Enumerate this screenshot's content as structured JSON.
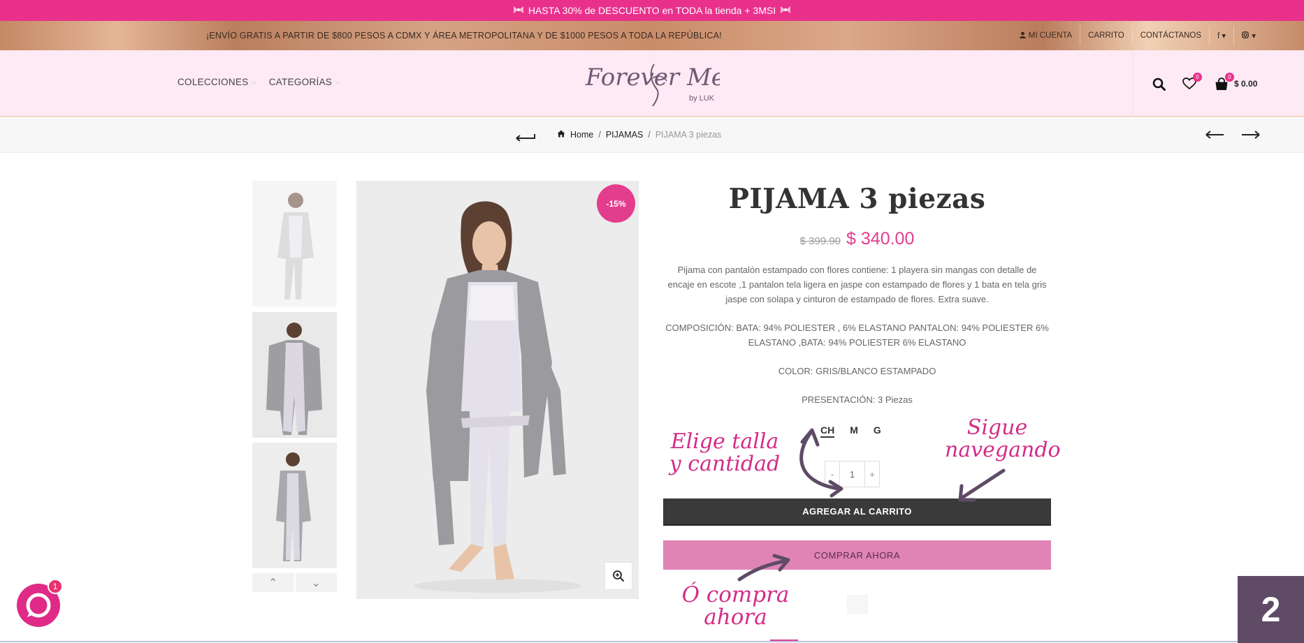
{
  "promo": {
    "text": "HASTA 30% de DESCUENTO en TODA la tienda + 3MSI",
    "icon": "ribbon-icon"
  },
  "top_bar": {
    "shipping": "¡ENVÍO GRATIS A PARTIR DE $800 PESOS A CDMX Y ÁREA METROPOLITANA Y DE $1000 PESOS A TODA LA REPÚBLICA!",
    "account": "MI CUENTA",
    "cart": "CARRITO",
    "contact": "CONTÁCTANOS",
    "facebook": "f ▾",
    "instagram": "▾"
  },
  "nav": {
    "collections": "COLECCIONES",
    "categories": "CATEGORÍAS"
  },
  "logo": {
    "text": "Forever Me",
    "sub": "by LUK"
  },
  "header": {
    "wishlist_count": "0",
    "cart_count": "0",
    "cart_total": "$ 0.00"
  },
  "breadcrumb": {
    "home": "Home",
    "category": "PIJAMAS",
    "current": "PIJAMA 3 piezas",
    "sep": "/"
  },
  "product": {
    "discount": "-15%",
    "title": "PIJAMA 3 piezas",
    "old_price": "$ 399.90",
    "price": "$ 340.00",
    "description": "Pijama con pantalón estampado con flores contiene: 1 playera sin mangas con detalle de encaje en escote ,1 pantalon tela ligera en jaspe con estampado de flores y 1 bata en tela gris jaspe con solapa y cinturon de estampado de flores. Extra suave.",
    "composition": "COMPOSICIÓN: BATA: 94% POLIESTER , 6% ELASTANO PANTALON: 94% POLIESTER 6% ELASTANO ,BATA: 94% POLIESTER 6% ELASTANO",
    "color": "COLOR: GRIS/BLANCO ESTAMPADO",
    "presentation": "PRESENTACIÓN: 3 Piezas",
    "sizes": [
      "CH",
      "M",
      "G"
    ],
    "selected_size": "CH",
    "quantity": "1",
    "qty_minus": "-",
    "qty_plus": "+",
    "add_to_cart": "AGREGAR AL CARRITO",
    "buy_now": "COMPRAR AHORA"
  },
  "annotations": {
    "choose": "Elige talla y cantidad",
    "keep": "Sigue navegando",
    "buy": "Ó compra ahora"
  },
  "widgets": {
    "chat_badge": "1",
    "page_number": "2"
  },
  "colors": {
    "promo": "#e9318c",
    "header_bg": "#fdeaf4",
    "price": "#e33d8e",
    "cart_button": "#3a3a3a",
    "buy_button": "#e084b6",
    "annotation": "#d42c87",
    "page_badge": "#5f4b66"
  }
}
